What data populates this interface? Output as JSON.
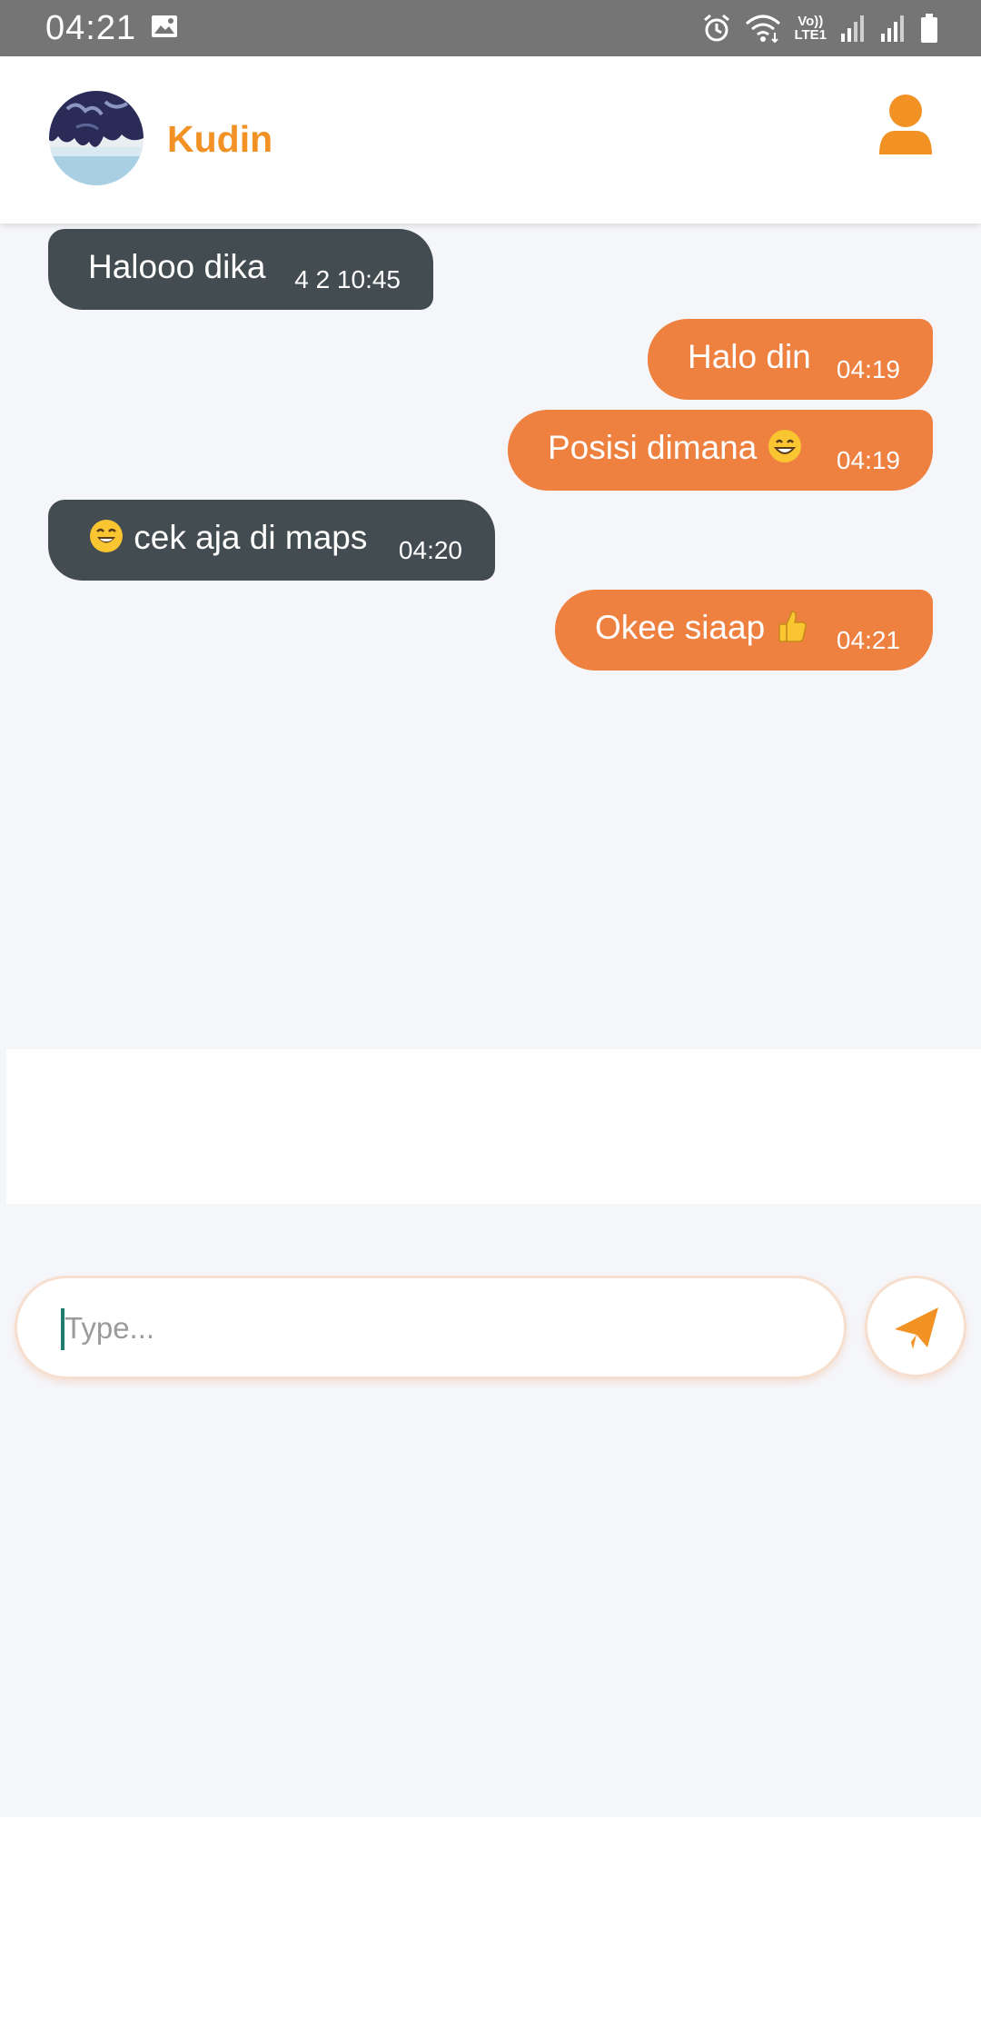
{
  "status_bar": {
    "time": "04:21",
    "volte_line1": "Vo))",
    "volte_line2": "LTE1"
  },
  "header": {
    "contact_name": "Kudin"
  },
  "messages": [
    {
      "direction": "in",
      "text": "Halooo dika",
      "time": "4 2 10:45"
    },
    {
      "direction": "out",
      "text": "Halo din",
      "time": "04:19"
    },
    {
      "direction": "out",
      "text": "Posisi dimana",
      "emoji": "grinning-face",
      "time": "04:19"
    },
    {
      "direction": "in",
      "text": "cek aja di maps",
      "emoji": "smiling-face",
      "time": "04:20"
    },
    {
      "direction": "out",
      "text": "Okee siaap",
      "emoji": "thumbs-up",
      "time": "04:21"
    }
  ],
  "composer": {
    "placeholder": "Type..."
  },
  "colors": {
    "accent": "#f29224",
    "outgoing_bubble": "#ee8040",
    "incoming_bubble": "#434c50",
    "background": "#f5f6fa",
    "status_bar": "#757575"
  },
  "icons": {
    "profile": "person-icon",
    "send": "paper-plane-icon"
  }
}
